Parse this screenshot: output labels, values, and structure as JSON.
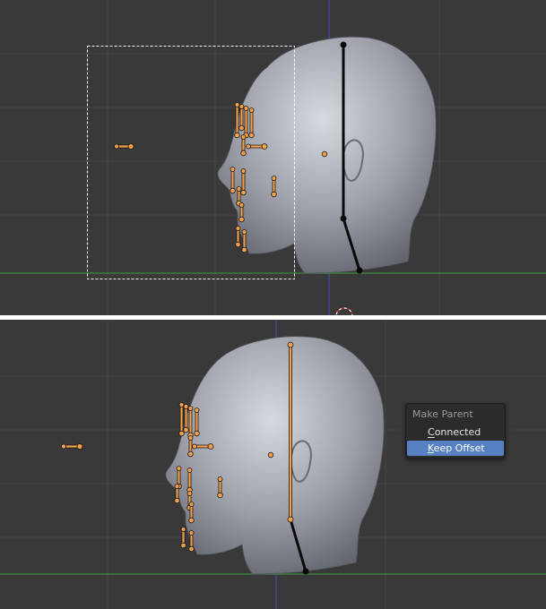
{
  "colors": {
    "viewport_bg": "#393939",
    "grid_line": "#424242",
    "axis_x": "#3c8c3c",
    "axis_z": "#4a4aa8",
    "bone_selected": "#f4a04a",
    "bone_outline": "#1a1a1a",
    "bone_unselected": "#0a0a0a",
    "head_mesh": "#8a8c95",
    "menu_bg": "#2b2b2b",
    "menu_highlight": "#5680c2"
  },
  "icons": [
    "bone-icon",
    "cursor-3d-icon"
  ],
  "make_parent_menu": {
    "title": "Make Parent",
    "items": [
      {
        "label": "Connected",
        "underline": "C"
      },
      {
        "label": "Keep Offset",
        "underline": "K"
      }
    ]
  }
}
